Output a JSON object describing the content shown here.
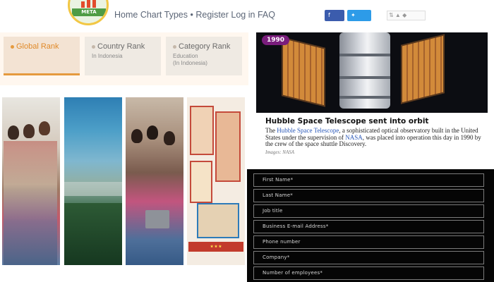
{
  "header": {
    "logo_text": "META",
    "nav": {
      "home": "Home",
      "chart_types": "Chart Types",
      "separator": "•",
      "register": "Register",
      "login": "Log in",
      "faq": "FAQ"
    },
    "share": {
      "facebook": "Share",
      "twitter": "Tweet"
    },
    "rank_widget_icon": "rank-arrows-icon"
  },
  "rank_tabs": [
    {
      "title": "Global Rank",
      "subtitle": ""
    },
    {
      "title": "Country Rank",
      "subtitle": "In Indonesia"
    },
    {
      "title": "Category Rank",
      "subtitle": "Education",
      "subtitle2": "(In Indonesia)"
    }
  ],
  "photos": [
    "students-group",
    "mountain-landscape",
    "students-laptop",
    "education-collage"
  ],
  "nasa_card": {
    "year": "1990",
    "title": "Hubble Space Telescope sent into orbit",
    "body_pre": "The ",
    "link1": "Hubble Space Telescope",
    "body_mid": ", a sophisticated optical observatory built in the United States under the supervision of ",
    "link2": "NASA",
    "body_post": ", was placed into operation this day in 1990 by the crew of the space shuttle Discovery.",
    "credit": "Images: NASA"
  },
  "form": {
    "fields": [
      "First Name*",
      "Last Name*",
      "Job title",
      "Business E-mail Address*",
      "Phone number",
      "Company*",
      "Number of employees*"
    ]
  },
  "colors": {
    "accent_orange": "#e59a3e",
    "facebook_blue": "#3b5cad",
    "twitter_blue": "#2d9be8",
    "year_badge": "#7a1d7c",
    "form_bg": "#050505"
  }
}
